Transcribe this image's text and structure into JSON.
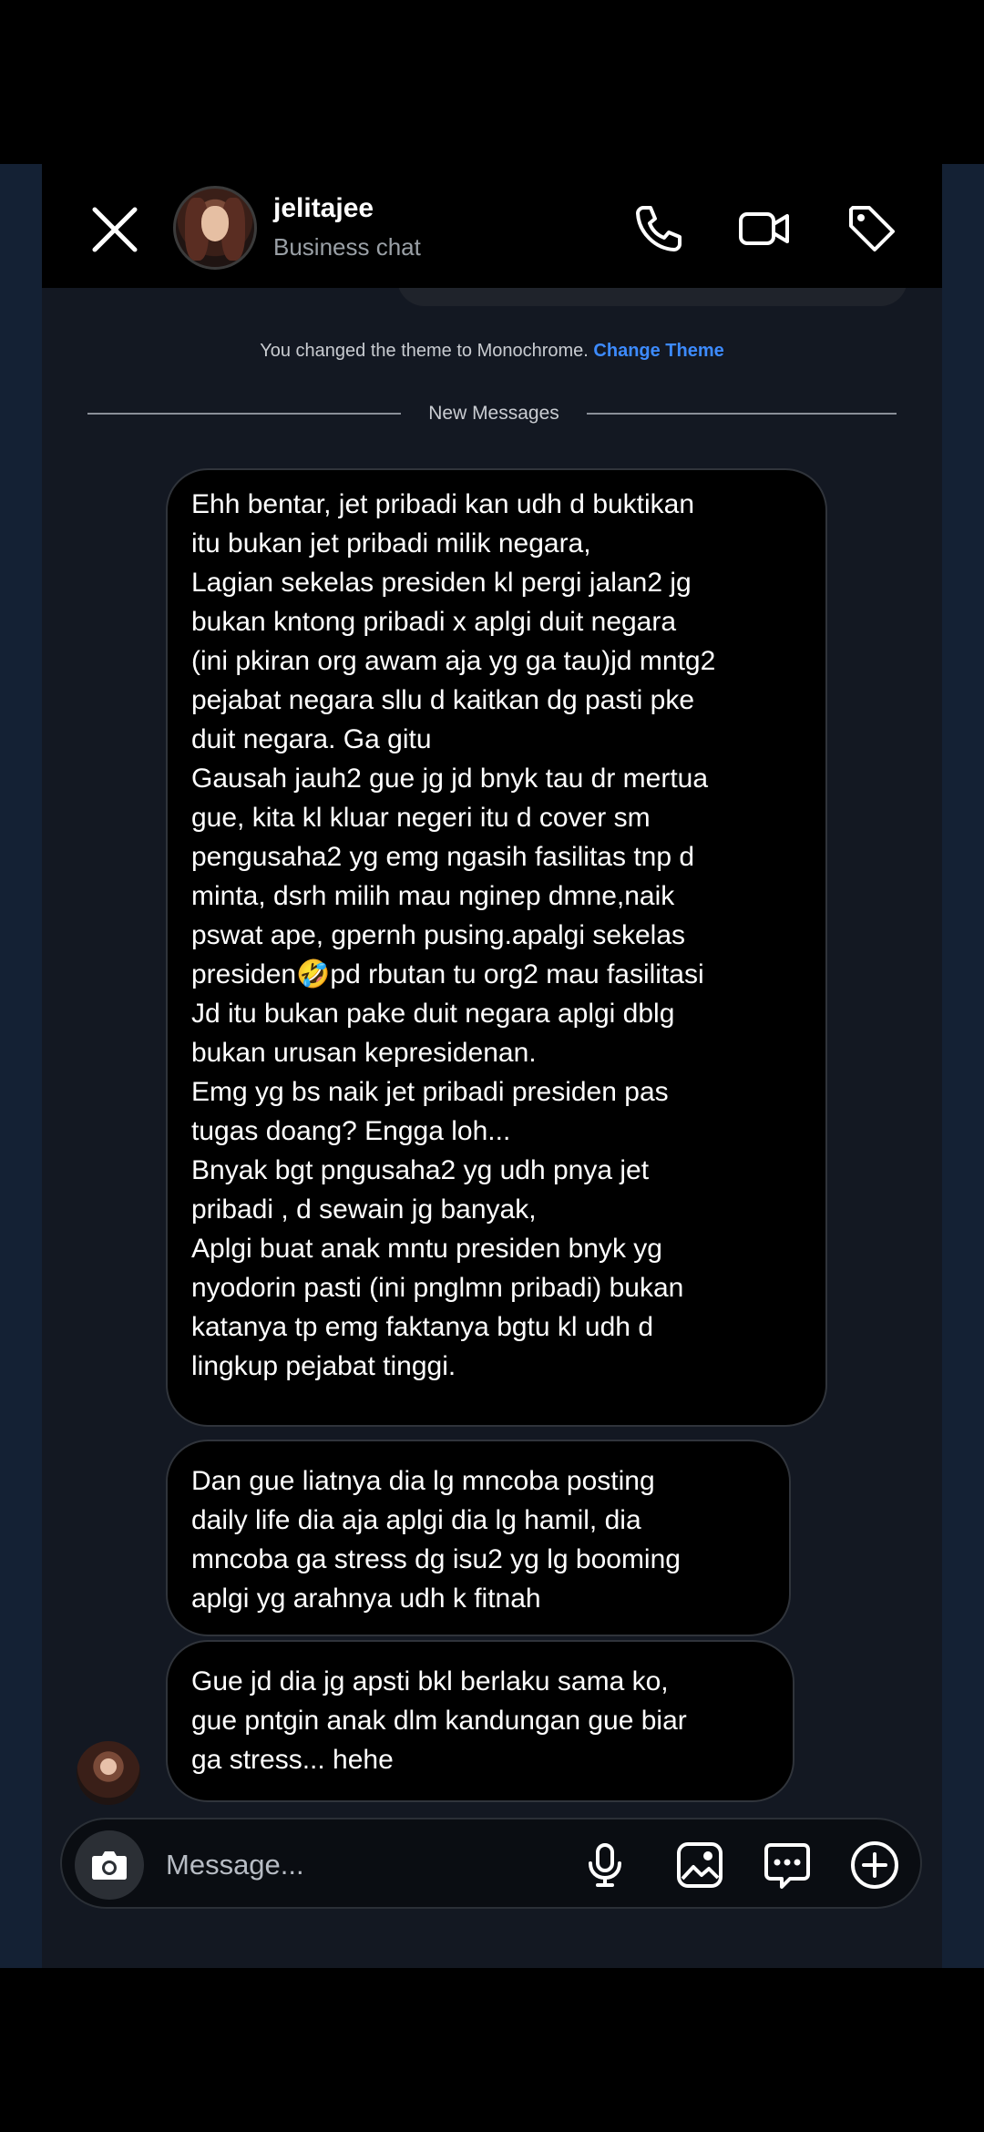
{
  "header": {
    "name": "jelitajee",
    "subtitle": "Business chat"
  },
  "system": {
    "text": "You changed the theme to Monochrome. ",
    "link": "Change Theme"
  },
  "divider_label": "New Messages",
  "messages": [
    {
      "text": "Ehh bentar, jet pribadi kan udh d buktikan\nitu bukan jet pribadi milik negara,\nLagian sekelas presiden kl pergi jalan2 jg\nbukan kntong pribadi x aplgi duit negara\n(ini pkiran org awam aja yg ga tau)jd mntg2\npejabat negara sllu d kaitkan dg pasti pke\nduit negara. Ga gitu\nGausah jauh2 gue jg jd bnyk tau dr mertua\ngue, kita kl kluar negeri itu d cover sm\npengusaha2 yg emg ngasih fasilitas tnp d\nminta, dsrh milih mau nginep dmne,naik\npswat ape, gpernh pusing.apalgi sekelas\npresiden🤣pd rbutan tu org2 mau fasilitasi\nJd itu bukan pake duit negara aplgi dblg\nbukan urusan kepresidenan.\nEmg yg bs naik jet pribadi presiden pas\ntugas doang? Engga loh...\nBnyak bgt pngusaha2 yg udh pnya jet\npribadi , d sewain jg banyak,\nAplgi buat anak mntu presiden bnyk yg\nnyodorin pasti (ini pnglmn pribadi) bukan\nkatanya tp emg faktanya bgtu kl udh d\nlingkup pejabat tinggi."
    },
    {
      "text": "Dan gue liatnya dia lg mncoba posting\ndaily life dia aja aplgi dia lg hamil, dia\nmncoba ga stress dg isu2 yg lg booming\naplgi yg arahnya udh k fitnah"
    },
    {
      "text": "Gue jd dia jg apsti bkl berlaku sama ko,\ngue pntgin anak dlm kandungan gue biar\nga stress... hehe"
    }
  ],
  "composer": {
    "placeholder": "Message..."
  },
  "icons": [
    "close-icon",
    "call-icon",
    "video-icon",
    "tag-icon",
    "camera-icon",
    "mic-icon",
    "gallery-icon",
    "sticker-icon",
    "plus-icon"
  ],
  "colors": {
    "background": "#131822",
    "bubble": "#000000",
    "link": "#3d8bff",
    "side": "#142134"
  }
}
